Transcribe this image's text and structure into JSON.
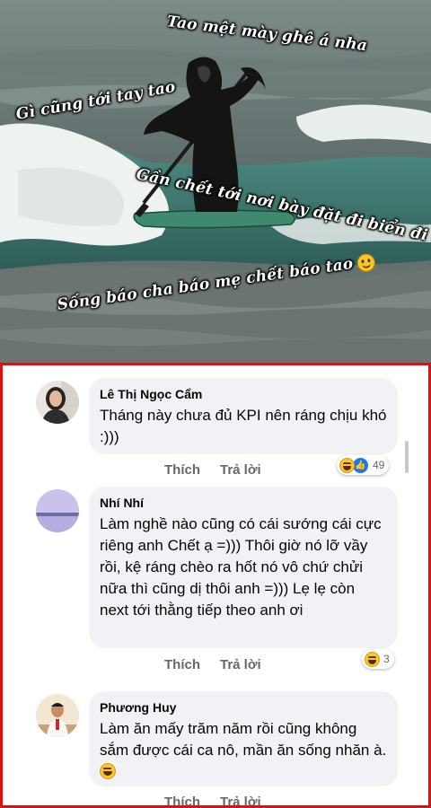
{
  "meme": {
    "captions": [
      "Tao mệt mày ghê á nha",
      "Gì cũng tới tay tao",
      "Gần chết tới nơi bày đặt đi biển đi ơ đồ",
      "Sống báo cha báo mẹ chết báo tao"
    ],
    "colors": {
      "sea": "#5f6d6c",
      "foam": "#eef2f1",
      "caption": "#ffffff"
    }
  },
  "comments": [
    {
      "author": "Lê Thị Ngọc Cẩm",
      "text": "Tháng này chưa đủ KPI nên ráng chịu khó :)))",
      "like_label": "Thích",
      "reply_label": "Trả lời",
      "reaction_count": "49",
      "reactions": [
        "haha-icon",
        "like-icon"
      ]
    },
    {
      "author": "Nhí Nhí",
      "text": "Làm nghề nào cũng có cái sướng cái cực riêng anh Chết ạ =))) Thôi giờ nó lỡ vầy rồi, kệ ráng chèo ra hốt nó vô chứ chửi nữa thì cũng dị thôi anh =))) Lẹ lẹ còn next tới thằng tiếp theo anh ơi",
      "like_label": "Thích",
      "reply_label": "Trả lời",
      "reaction_count": "3",
      "reactions": [
        "haha-icon"
      ]
    },
    {
      "author": "Phương Huy",
      "text": "Làm ăn mấy trăm năm rồi cũng không sắm được cái ca nô, mần ăn sống nhăn à.",
      "like_label": "Thích",
      "reply_label": "Trả lời",
      "trailing_emoji": "laughing-emoji-icon"
    }
  ],
  "colors": {
    "highlight_border": "#e01010",
    "bubble": "#f0f2f5",
    "action_text": "#65676b",
    "like_blue": "#1877f2"
  }
}
